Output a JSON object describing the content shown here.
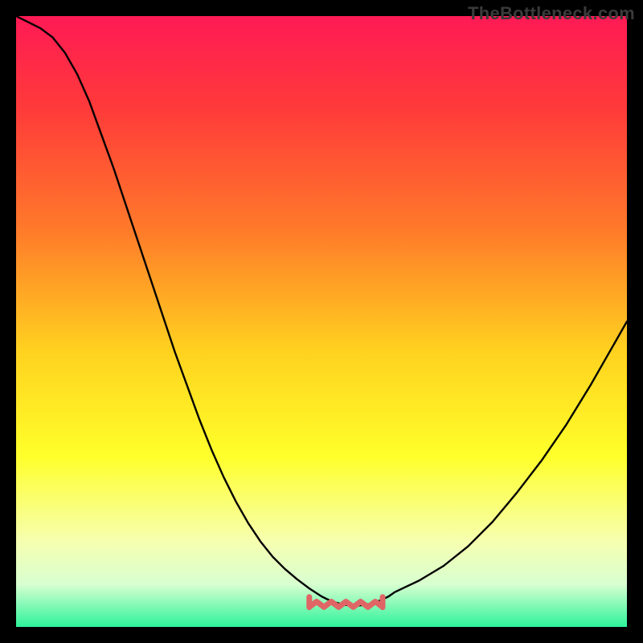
{
  "watermark": "TheBottleneck.com",
  "gradient": {
    "stops": [
      {
        "offset": 0.0,
        "color": "#ff1a55"
      },
      {
        "offset": 0.15,
        "color": "#ff3a3a"
      },
      {
        "offset": 0.35,
        "color": "#ff7a2a"
      },
      {
        "offset": 0.55,
        "color": "#ffd21f"
      },
      {
        "offset": 0.72,
        "color": "#ffff2a"
      },
      {
        "offset": 0.86,
        "color": "#f6ffb0"
      },
      {
        "offset": 0.93,
        "color": "#d8ffd0"
      },
      {
        "offset": 1.0,
        "color": "#2cf39a"
      }
    ]
  },
  "chart_data": {
    "type": "line",
    "title": "",
    "xlabel": "",
    "ylabel": "",
    "xlim": [
      0,
      100
    ],
    "ylim": [
      0,
      100
    ],
    "series": [
      {
        "name": "curve",
        "color": "#000000",
        "x": [
          0,
          2,
          4,
          6,
          8,
          10,
          12,
          14,
          16,
          18,
          20,
          22,
          24,
          26,
          28,
          30,
          32,
          34,
          36,
          38,
          40,
          42,
          44,
          46,
          48,
          50,
          51,
          52,
          53,
          54,
          55,
          56,
          57,
          58,
          59,
          60,
          61,
          62,
          66,
          70,
          74,
          78,
          82,
          86,
          90,
          94,
          98,
          100
        ],
        "y": [
          100,
          99,
          98,
          96.5,
          94,
          90.5,
          86,
          80.5,
          75,
          69,
          63,
          57,
          51,
          45,
          39.5,
          34,
          29,
          24.5,
          20.5,
          17,
          14,
          11.5,
          9.5,
          7.8,
          6.3,
          5,
          4.5,
          4.1,
          3.8,
          3.6,
          3.5,
          3.5,
          3.6,
          3.8,
          4.1,
          4.5,
          5,
          5.7,
          7.6,
          10,
          13.2,
          17.2,
          22,
          27.2,
          33,
          39.5,
          46.5,
          50
        ]
      }
    ],
    "annotations": [
      {
        "name": "trough-squiggle",
        "color": "#e06666",
        "x_range": [
          48,
          60
        ],
        "y_level": 3.7
      }
    ]
  }
}
